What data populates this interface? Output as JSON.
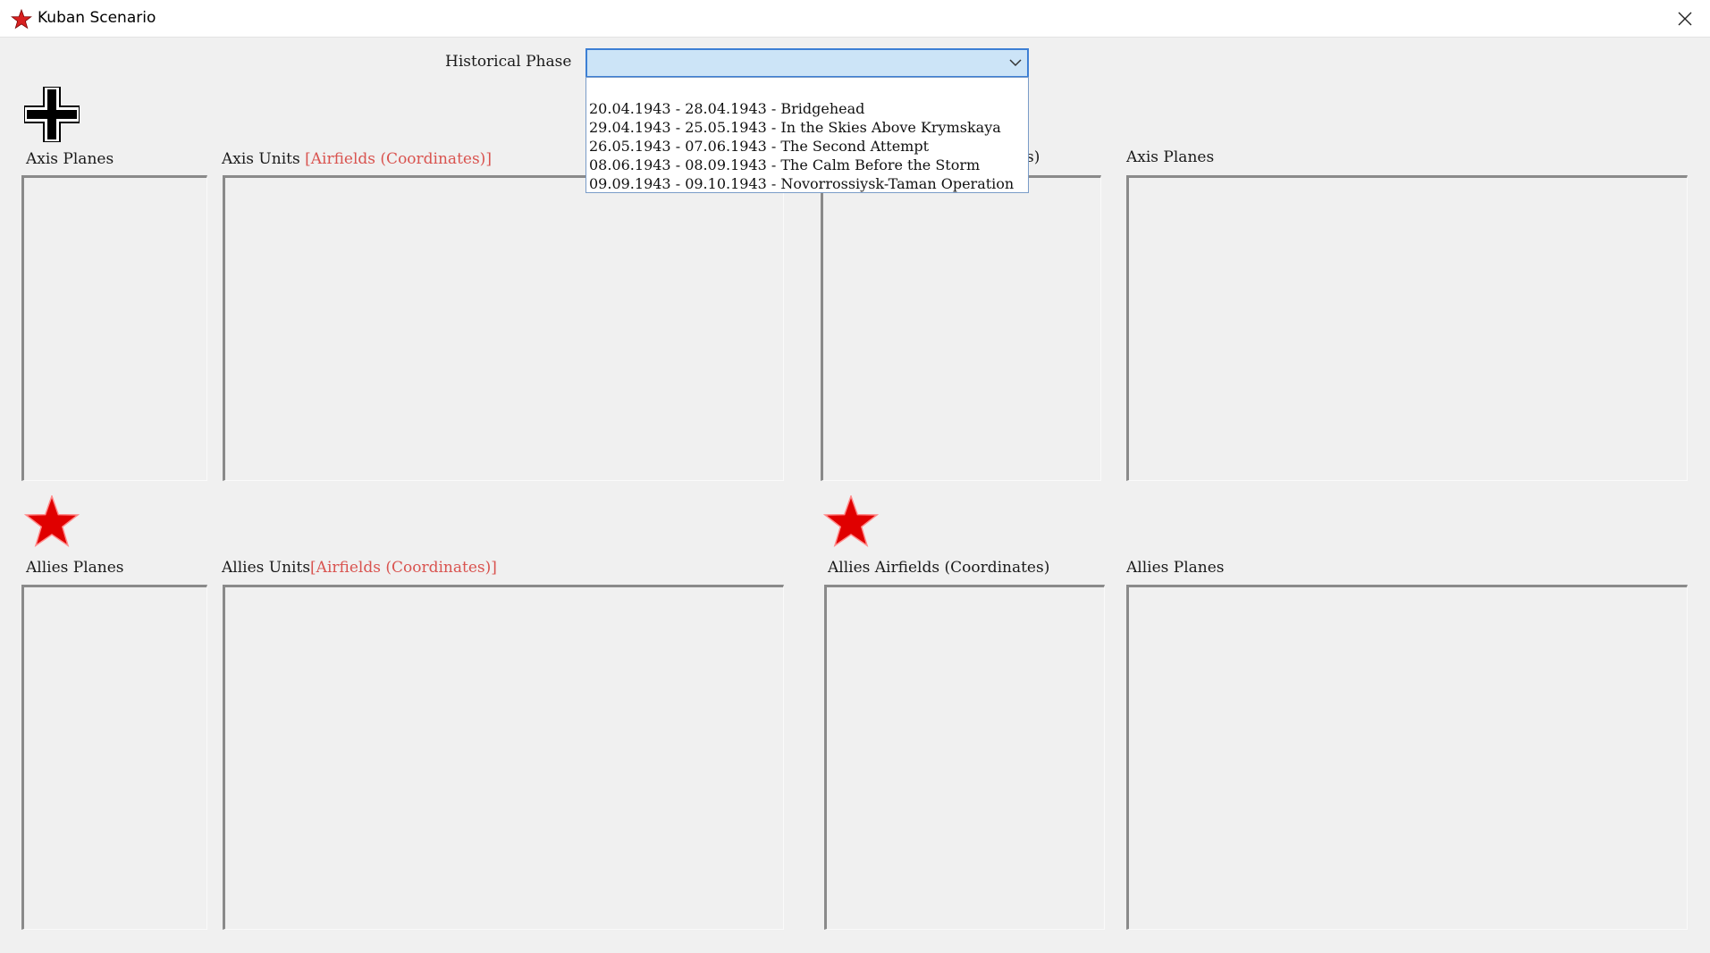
{
  "window": {
    "title": "Kuban Scenario",
    "icon": "red-star-icon"
  },
  "phase": {
    "label": "Historical Phase",
    "selected": "",
    "options": [
      "20.04.1943 - 28.04.1943 - Bridgehead",
      "29.04.1943 - 25.05.1943 - In the Skies Above Krymskaya",
      "26.05.1943 - 07.06.1943 - The Second Attempt",
      "08.06.1943 - 08.09.1943 - The Calm Before the Storm",
      "09.09.1943 - 09.10.1943 - Novorrossiysk-Taman Operation"
    ]
  },
  "axis": {
    "icon": "balkenkreuz-icon",
    "planes_left": "Axis Planes",
    "units_label": "Axis Units",
    "units_extra": "[Airfields (Coordinates)]",
    "airfields_visible_tail": "s)",
    "planes_right": "Axis Planes"
  },
  "allies": {
    "icon": "red-star-icon",
    "planes_left": "Allies Planes",
    "units_label": "Allies Units",
    "units_extra": "[Airfields (Coordinates)]",
    "airfields": "Allies Airfields (Coordinates)",
    "planes_right": "Allies Planes"
  },
  "colors": {
    "accent_red": "#d9534f",
    "star_red": "#e00000",
    "combo_focus": "#cce4f7"
  }
}
